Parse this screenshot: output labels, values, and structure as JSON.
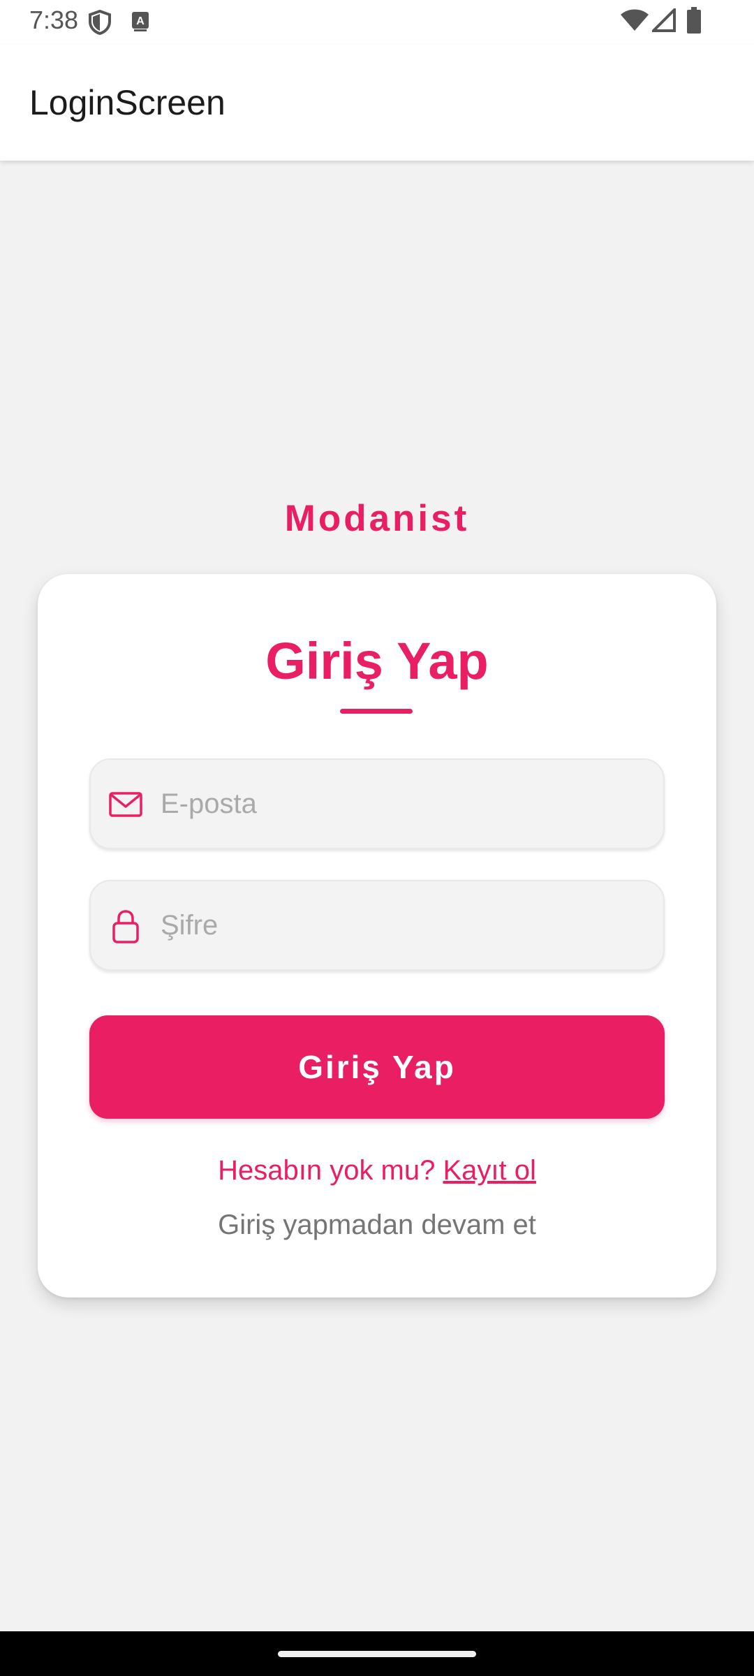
{
  "status_bar": {
    "time": "7:38",
    "left_icons": [
      "shield-icon",
      "keyboard-a-icon"
    ],
    "right_icons": [
      "wifi-icon",
      "signal-icon",
      "battery-icon"
    ]
  },
  "app_bar": {
    "title": "LoginScreen"
  },
  "brand": {
    "name": "Modanist"
  },
  "login_card": {
    "title": "Giriş Yap",
    "email": {
      "placeholder": "E-posta",
      "value": "",
      "icon": "mail-icon"
    },
    "password": {
      "placeholder": "Şifre",
      "value": "",
      "icon": "lock-icon"
    },
    "login_button_label": "Giriş Yap",
    "signup_prompt": "Hesabın yok mu?",
    "signup_link": "Kayıt ol",
    "guest_link": "Giriş yapmadan devam et"
  },
  "colors": {
    "accent": "#e91e63",
    "background": "#f2f2f2",
    "card": "#ffffff",
    "muted_text": "#757575",
    "placeholder": "#a9a9a9"
  }
}
